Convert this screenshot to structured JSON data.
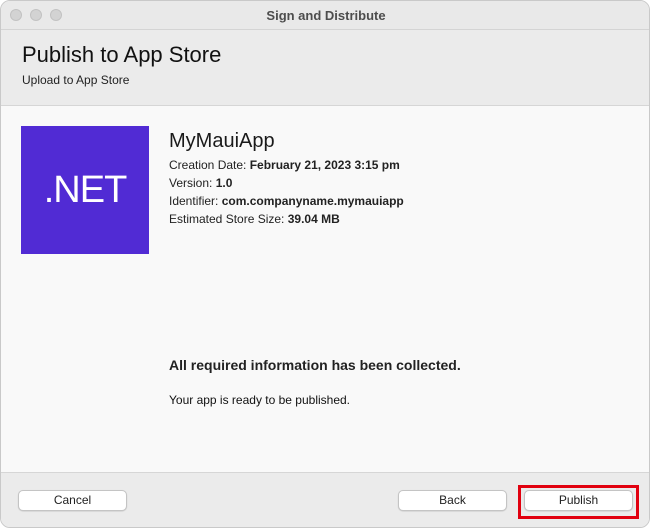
{
  "window": {
    "title": "Sign and Distribute"
  },
  "header": {
    "title": "Publish to App Store",
    "subtitle": "Upload to App Store"
  },
  "app": {
    "logo_text": ".NET",
    "logo_color": "#512bd4",
    "name": "MyMauiApp",
    "creation_date_label": "Creation Date:",
    "creation_date": "February 21, 2023 3:15 pm",
    "version_label": "Version:",
    "version": "1.0",
    "identifier_label": "Identifier:",
    "identifier": "com.companyname.mymauiapp",
    "size_label": "Estimated Store Size:",
    "size": "39.04 MB"
  },
  "status": {
    "heading": "All required information has been collected.",
    "message": "Your app is ready to be published."
  },
  "footer": {
    "cancel_label": "Cancel",
    "back_label": "Back",
    "publish_label": "Publish",
    "highlight_color": "#e1000f"
  }
}
